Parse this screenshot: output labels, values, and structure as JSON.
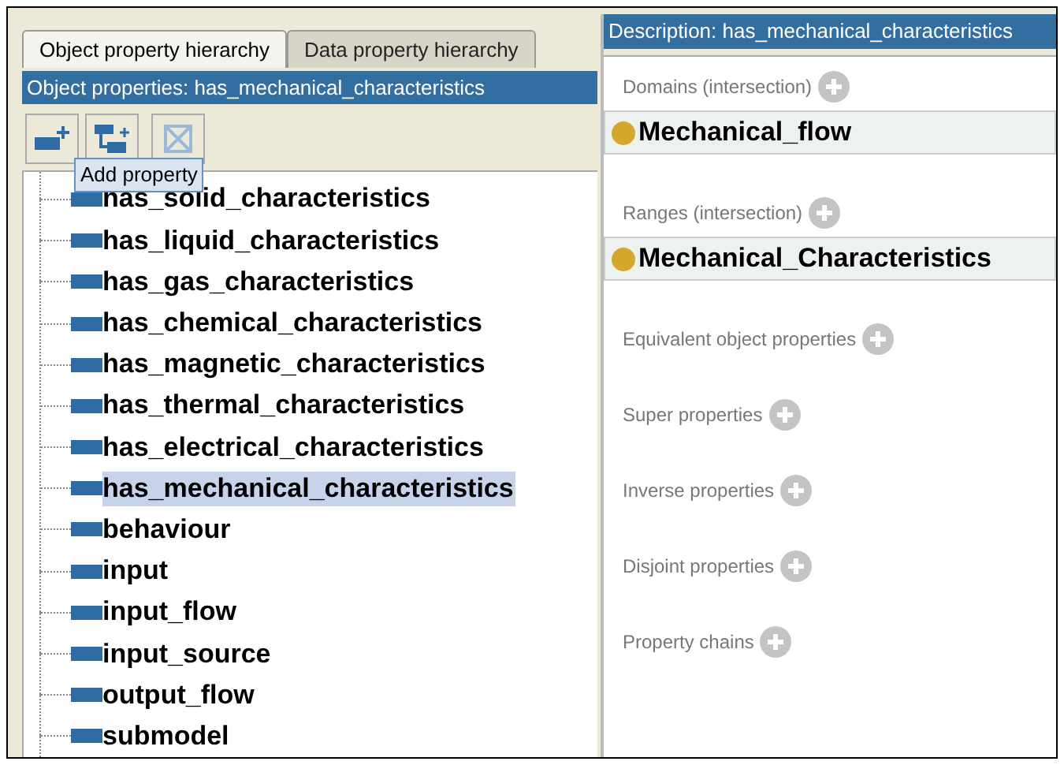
{
  "tabs": [
    {
      "label": "Object property hierarchy",
      "selected": true
    },
    {
      "label": "Data property hierarchy",
      "selected": false
    }
  ],
  "hierarchy_header": "Object properties: has_mechanical_characteristics",
  "tooltip": "Add property",
  "tree": [
    {
      "label": "has_solid_characteristics",
      "selected": false
    },
    {
      "label": "has_liquid_characteristics",
      "selected": false
    },
    {
      "label": "has_gas_characteristics",
      "selected": false
    },
    {
      "label": "has_chemical_characteristics",
      "selected": false
    },
    {
      "label": "has_magnetic_characteristics",
      "selected": false
    },
    {
      "label": "has_thermal_characteristics",
      "selected": false
    },
    {
      "label": "has_electrical_characteristics",
      "selected": false
    },
    {
      "label": "has_mechanical_characteristics",
      "selected": true
    },
    {
      "label": "behaviour",
      "selected": false
    },
    {
      "label": "input",
      "selected": false
    },
    {
      "label": "input_flow",
      "selected": false
    },
    {
      "label": "input_source",
      "selected": false
    },
    {
      "label": "output_flow",
      "selected": false
    },
    {
      "label": "submodel",
      "selected": false
    }
  ],
  "description_header": "Description: has_mechanical_characteristics",
  "sections": [
    {
      "label": "Domains (intersection)",
      "items": [
        {
          "label": "Mechanical_flow",
          "color": "#d4a82c"
        }
      ]
    },
    {
      "label": "Ranges (intersection)",
      "items": [
        {
          "label": "Mechanical_Characteristics",
          "color": "#d4a82c"
        }
      ]
    },
    {
      "label": "Equivalent object properties"
    },
    {
      "label": "Super properties"
    },
    {
      "label": "Inverse properties"
    },
    {
      "label": "Disjoint properties"
    },
    {
      "label": "Property chains"
    }
  ]
}
